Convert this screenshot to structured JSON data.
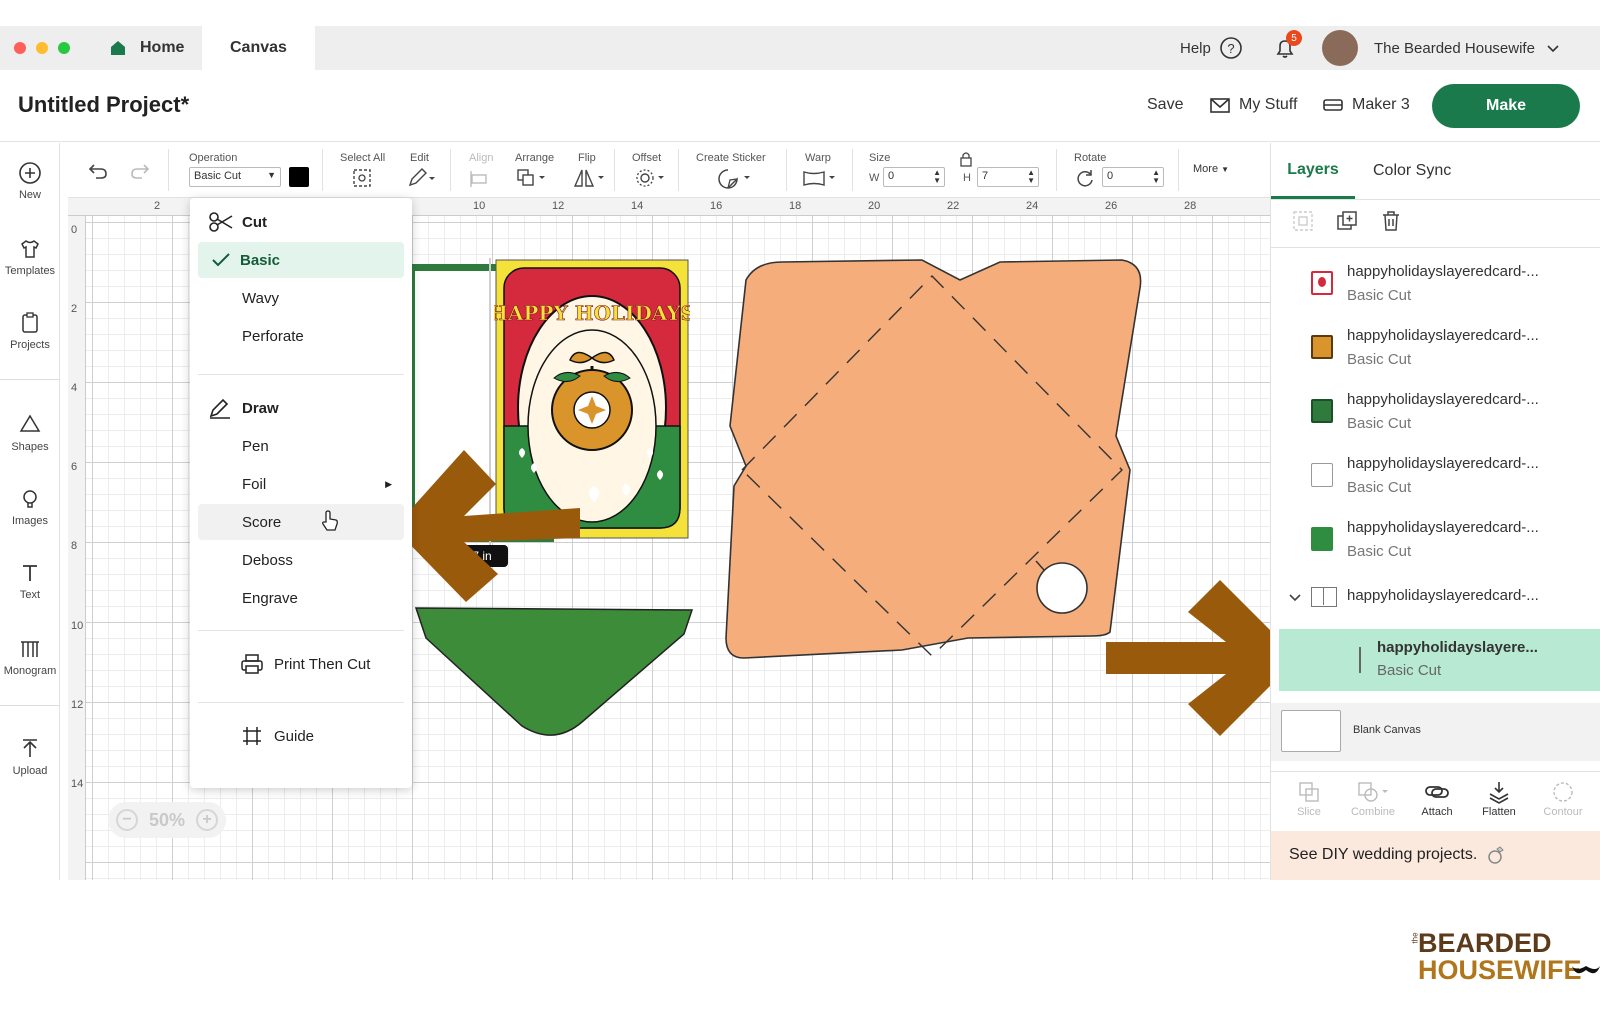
{
  "colors": {
    "accent": "#1b7a4b",
    "selected_layer_bg": "#b8ead3",
    "envelope": "#f5ad7c",
    "arrow": "#9a5a0c",
    "promo_bg": "#fbe9dd"
  },
  "tabs": {
    "home": "Home",
    "canvas": "Canvas"
  },
  "top_right": {
    "help": "Help",
    "notification_count": "5",
    "user": "The Bearded Housewife"
  },
  "project": {
    "title": "Untitled Project*",
    "save": "Save",
    "my_stuff": "My Stuff",
    "machine": "Maker 3",
    "make": "Make"
  },
  "rail": {
    "new": "New",
    "templates": "Templates",
    "projects": "Projects",
    "shapes": "Shapes",
    "images": "Images",
    "text": "Text",
    "monogram": "Monogram",
    "upload": "Upload"
  },
  "toolbar": {
    "operation_label": "Operation",
    "operation_value": "Basic Cut",
    "select_all": "Select All",
    "edit": "Edit",
    "align": "Align",
    "arrange": "Arrange",
    "flip": "Flip",
    "offset": "Offset",
    "create_sticker": "Create Sticker",
    "warp": "Warp",
    "size": "Size",
    "w_label": "W",
    "w_value": "0",
    "h_label": "H",
    "h_value": "7",
    "rotate": "Rotate",
    "rotate_value": "0",
    "more": "More"
  },
  "rulers": {
    "top": [
      "2",
      "10",
      "12",
      "14",
      "16",
      "18",
      "20",
      "22",
      "24",
      "26",
      "28"
    ],
    "left": [
      "0",
      "2",
      "4",
      "6",
      "8",
      "10",
      "12",
      "14"
    ]
  },
  "canvas": {
    "zoom": "50%",
    "size_tooltip": "7 in",
    "card_text": "HAPPY HOLIDAYS"
  },
  "operation_menu": {
    "cut_header": "Cut",
    "cut_items": [
      "Basic",
      "Wavy",
      "Perforate"
    ],
    "draw_header": "Draw",
    "draw_items": [
      "Pen",
      "Foil",
      "Score",
      "Deboss",
      "Engrave"
    ],
    "print_then_cut": "Print Then Cut",
    "guide": "Guide"
  },
  "panel": {
    "tab_layers": "Layers",
    "tab_color_sync": "Color Sync",
    "layers": [
      {
        "name": "happyholidayslayeredcard-...",
        "op": "Basic Cut"
      },
      {
        "name": "happyholidayslayeredcard-...",
        "op": "Basic Cut"
      },
      {
        "name": "happyholidayslayeredcard-...",
        "op": "Basic Cut"
      },
      {
        "name": "happyholidayslayeredcard-...",
        "op": "Basic Cut"
      },
      {
        "name": "happyholidayslayeredcard-...",
        "op": "Basic Cut"
      }
    ],
    "group_name": "happyholidayslayeredcard-...",
    "selected_layer": {
      "name": "happyholidayslayere...",
      "op": "Basic Cut"
    },
    "blank_canvas": "Blank Canvas",
    "tools": [
      "Slice",
      "Combine",
      "Attach",
      "Flatten",
      "Contour"
    ],
    "promo": "See DIY wedding projects."
  },
  "brand": {
    "line_small": "the",
    "line1": "BEARDED",
    "line2": "HOUSEWIFE"
  }
}
